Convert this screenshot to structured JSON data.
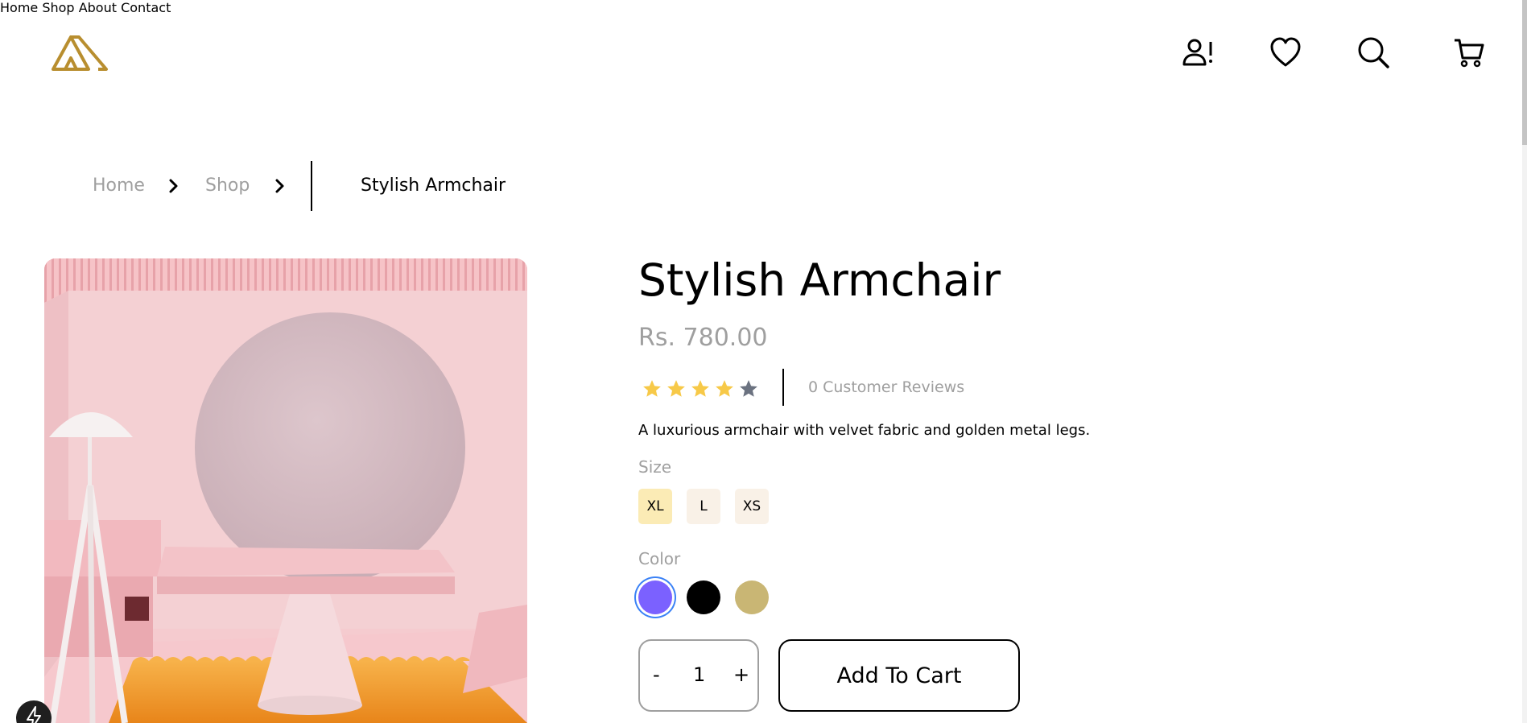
{
  "nav": {
    "items": [
      {
        "label": "Home"
      },
      {
        "label": "Shop"
      },
      {
        "label": "About"
      },
      {
        "label": "Contact"
      }
    ]
  },
  "header_icons": [
    "account-alert-icon",
    "heart-icon",
    "search-icon",
    "cart-icon"
  ],
  "breadcrumb": {
    "items": [
      {
        "label": "Home"
      },
      {
        "label": "Shop"
      }
    ],
    "current": "Stylish Armchair"
  },
  "product": {
    "title": "Stylish Armchair",
    "price": "Rs. 780.00",
    "rating": 4,
    "rating_max": 5,
    "reviews": "0 Customer Reviews",
    "description": "A luxurious armchair with velvet fabric and golden metal legs.",
    "size_label": "Size",
    "sizes": [
      {
        "label": "XL",
        "selected": true
      },
      {
        "label": "L",
        "selected": false
      },
      {
        "label": "XS",
        "selected": false
      }
    ],
    "color_label": "Color",
    "colors": [
      {
        "hex": "#7b61ff",
        "selected": true
      },
      {
        "hex": "#000000",
        "selected": false
      },
      {
        "hex": "#c9b674",
        "selected": false
      }
    ],
    "quantity": {
      "minus": "-",
      "value": "1",
      "plus": "+"
    },
    "add_to_cart": "Add To Cart"
  },
  "theme": {
    "brand": "#b88e2f",
    "muted": "#9f9f9f",
    "star_filled": "#f7c948",
    "star_empty": "#6b7280",
    "size_selected_bg": "#fbebb5",
    "size_bg": "#f9f1e7"
  }
}
